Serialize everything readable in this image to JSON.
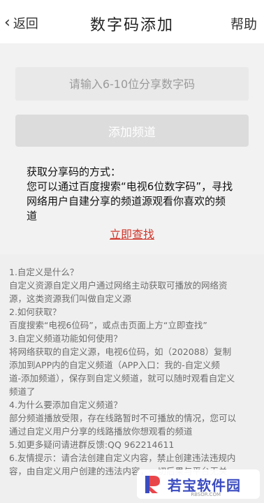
{
  "header": {
    "back_label": "返回",
    "title": "数字码添加",
    "help_label": "帮助"
  },
  "form": {
    "input_placeholder": "请输入6-10位分享数字码",
    "input_value": "",
    "add_button": "添加频道"
  },
  "how_to": {
    "lines": [
      "获取分享码的方式：",
      "您可以通过百度搜索“电视6位数字码”，寻找",
      "网络用户自建分享的频道源观看你喜欢的频",
      "道"
    ],
    "find_link": "立即查找"
  },
  "faq": {
    "lines": [
      "1.自定义是什么？",
      "自定义资源自定义用户通过网络主动获取可播放的网络资",
      "源，这类资源我们叫做自定义源",
      "2.如何获取？",
      "百度搜索“电视6位码”，或点击页面上方“立即查找”",
      "3.自定义频道功能如何使用？",
      "将网络获取的自定义源，电视6位码，如（202088）复制",
      "添加到APP内的自定义频道（APP入口：我的-自定义频",
      "道-添加频道），保存到自定义频道，就可以随时观看自定义",
      "频道了",
      "4.为什么要添加自定义频道？",
      "部分频道播放受限，存在线路暂时不可播放的情况，您可以",
      "通过自定义用户分享的线路播放你想观看的频道",
      "5.如更多疑问请进群反馈:QQ 962214611",
      "6.友情提示：请合法创建自定义内容，禁止创建违法违规内",
      "容，由自定义用户创建的违法内容，一切后果与平台无关"
    ]
  },
  "watermark": {
    "text": "若宝软件园",
    "sub": "RBSOR.COM"
  },
  "colors": {
    "link": "#d0352a",
    "button_bg": "#dcdcdc",
    "page_bg": "#f2f2f2",
    "watermark_brand": "#3b4cc0"
  }
}
